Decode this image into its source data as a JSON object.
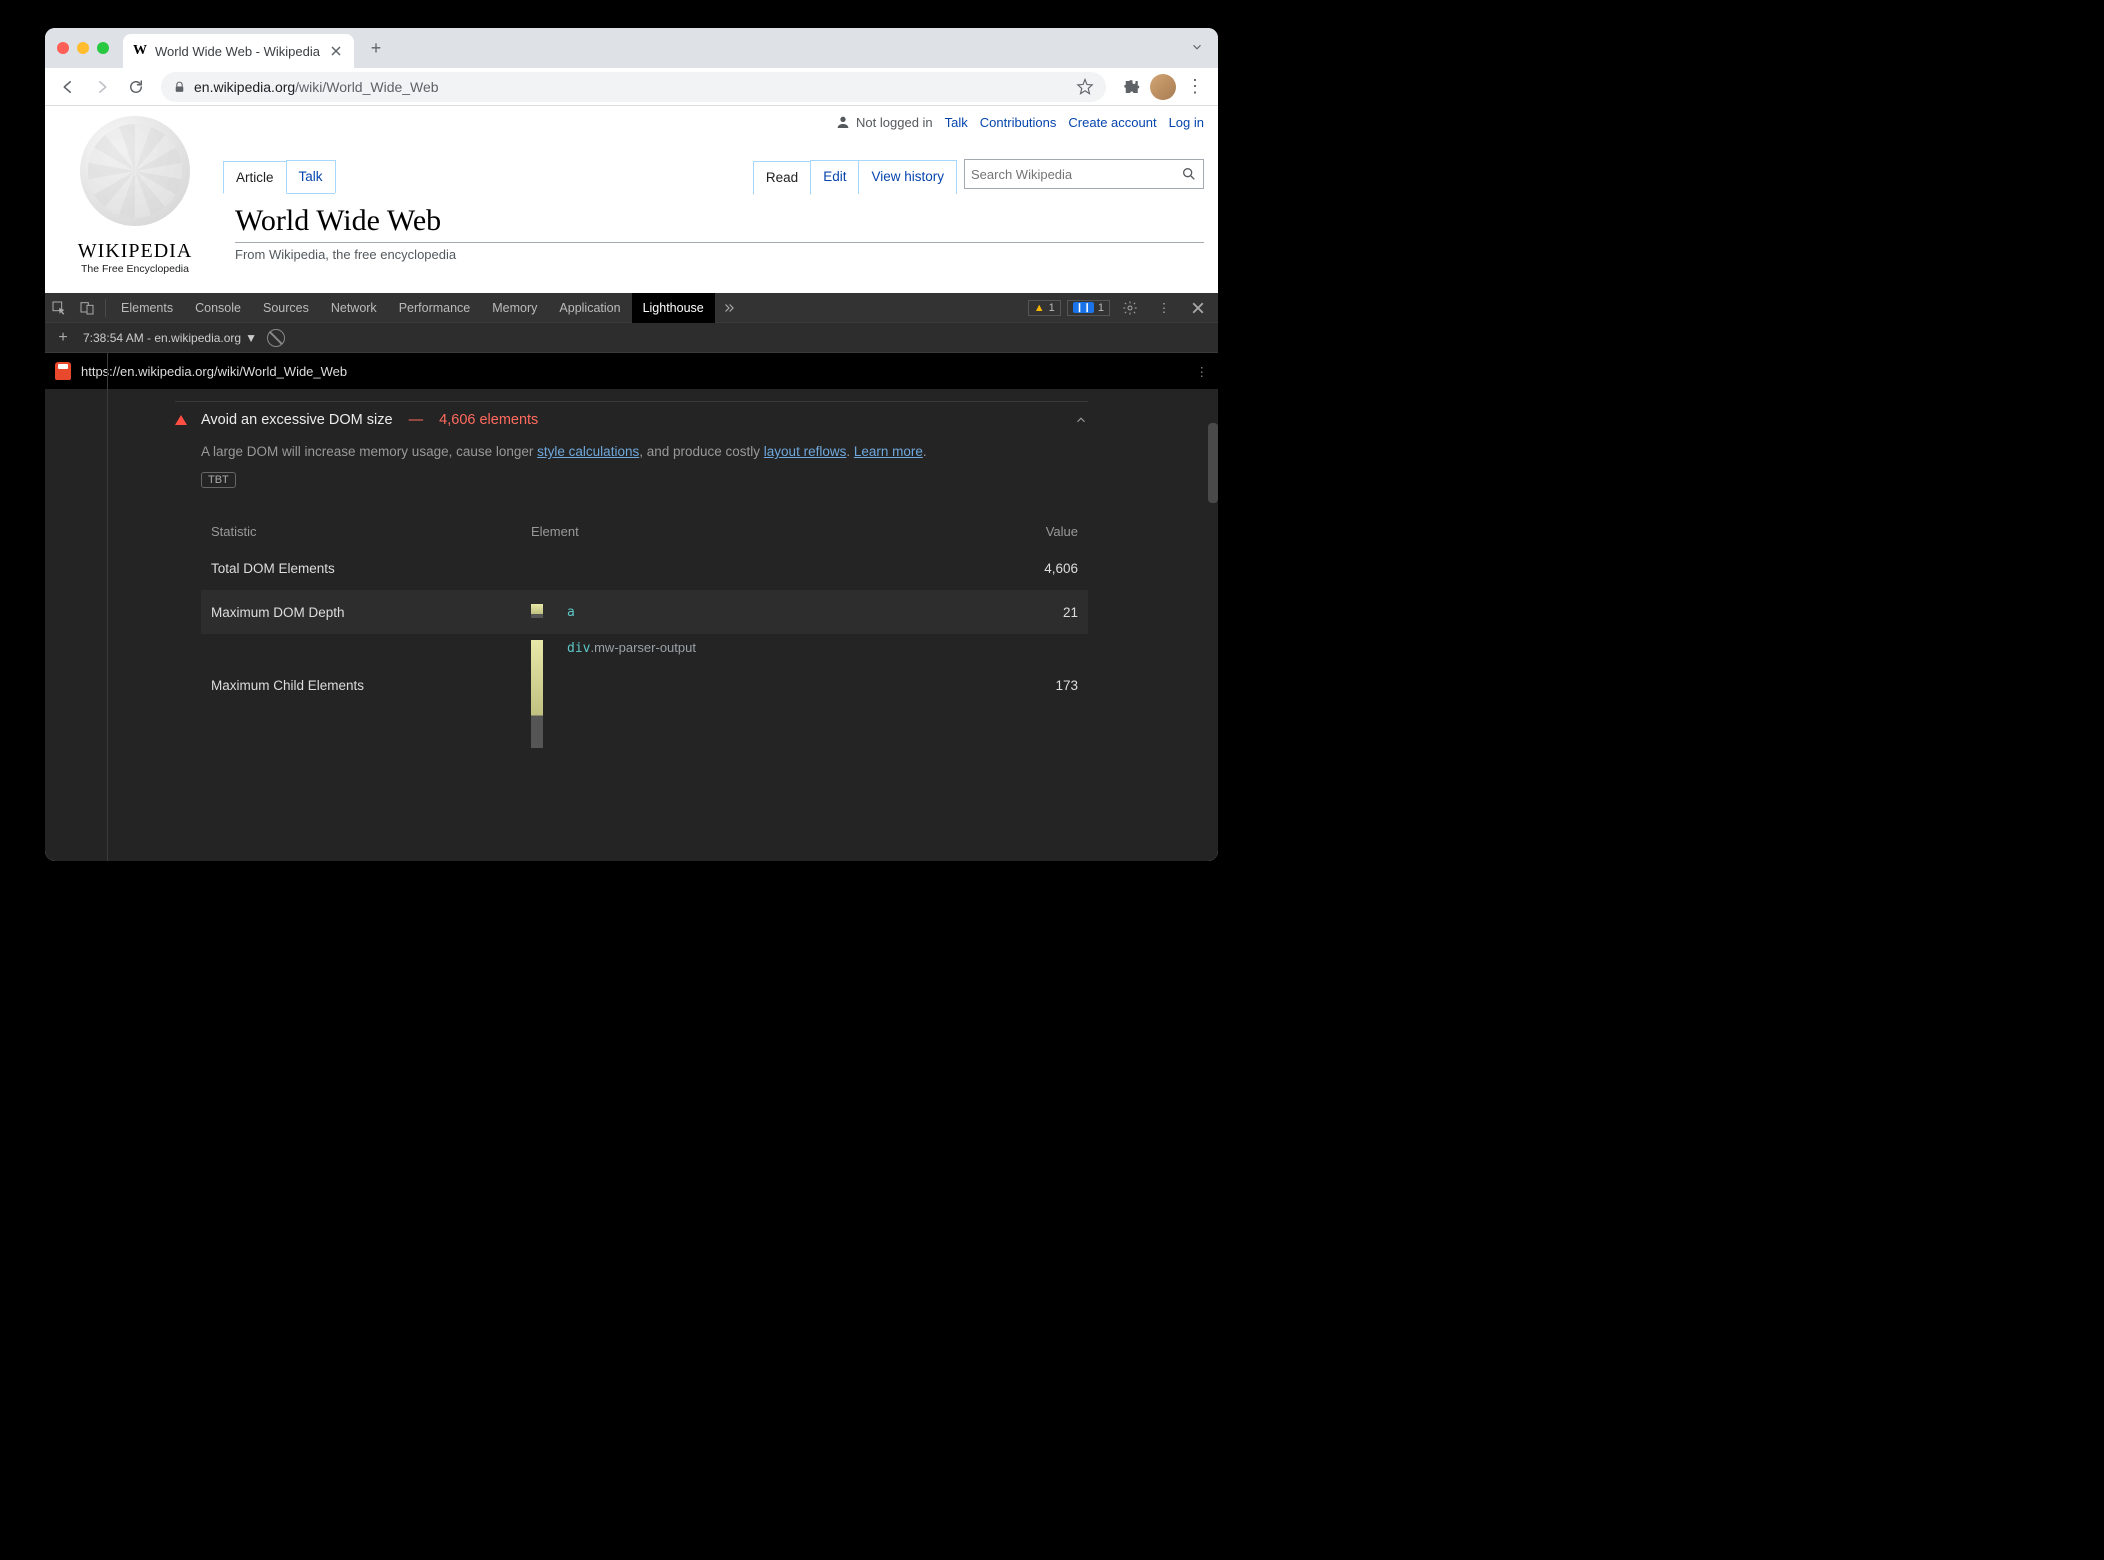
{
  "browser": {
    "tab_title": "World Wide Web - Wikipedia",
    "url_domain": "en.wikipedia.org",
    "url_path": "/wiki/World_Wide_Web"
  },
  "page": {
    "wordmark": "WIKIPEDIA",
    "tagline": "The Free Encyclopedia",
    "top_links": {
      "not_logged": "Not logged in",
      "talk": "Talk",
      "contrib": "Contributions",
      "create_acct": "Create account",
      "login": "Log in"
    },
    "ns_tabs": {
      "article": "Article",
      "talk": "Talk"
    },
    "action_tabs": {
      "read": "Read",
      "edit": "Edit",
      "history": "View history"
    },
    "search_placeholder": "Search Wikipedia",
    "title": "World Wide Web",
    "sub": "From Wikipedia, the free encyclopedia"
  },
  "devtools": {
    "tabs": {
      "elements": "Elements",
      "console": "Console",
      "sources": "Sources",
      "network": "Network",
      "performance": "Performance",
      "memory": "Memory",
      "application": "Application",
      "lighthouse": "Lighthouse"
    },
    "warn_count": "1",
    "info_count": "1",
    "session": "7:38:54 AM - en.wikipedia.org",
    "lh_url": "https://en.wikipedia.org/wiki/World_Wide_Web",
    "audit": {
      "title": "Avoid an excessive DOM size",
      "metric": "4,606 elements",
      "desc_pre": "A large DOM will increase memory usage, cause longer ",
      "link1": "style calculations",
      "desc_mid": ", and produce costly ",
      "link2": "layout reflows",
      "desc_post": ". ",
      "learn": "Learn more",
      "tbt": "TBT"
    },
    "table": {
      "h_stat": "Statistic",
      "h_elem": "Element",
      "h_val": "Value",
      "rows": [
        {
          "stat": "Total DOM Elements",
          "elem_code": "",
          "val": "4,606"
        },
        {
          "stat": "Maximum DOM Depth",
          "elem_code": "a",
          "val": "21"
        },
        {
          "stat": "Maximum Child Elements",
          "elem_code": "div.mw-parser-output",
          "val": "173"
        }
      ]
    }
  }
}
